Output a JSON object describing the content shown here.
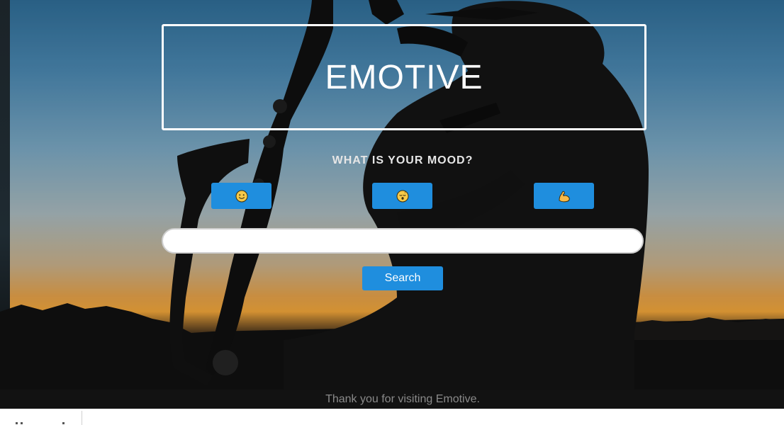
{
  "app": {
    "title": "EMOTIVE"
  },
  "mood": {
    "question": "WHAT IS YOUR MOOD?",
    "buttons": [
      {
        "icon": "slightly-smiling-face-icon",
        "emoji": "🙂"
      },
      {
        "icon": "sleeping-face-icon",
        "emoji": "😴"
      },
      {
        "icon": "flexed-biceps-icon",
        "emoji": "💪"
      }
    ]
  },
  "search": {
    "value": "",
    "placeholder": "",
    "button_label": "Search"
  },
  "footer": {
    "text": "Thank you for visiting Emotive."
  },
  "colors": {
    "accent": "#1f8ede",
    "footer_bg": "#121212",
    "footer_text": "#8a8a8a"
  }
}
